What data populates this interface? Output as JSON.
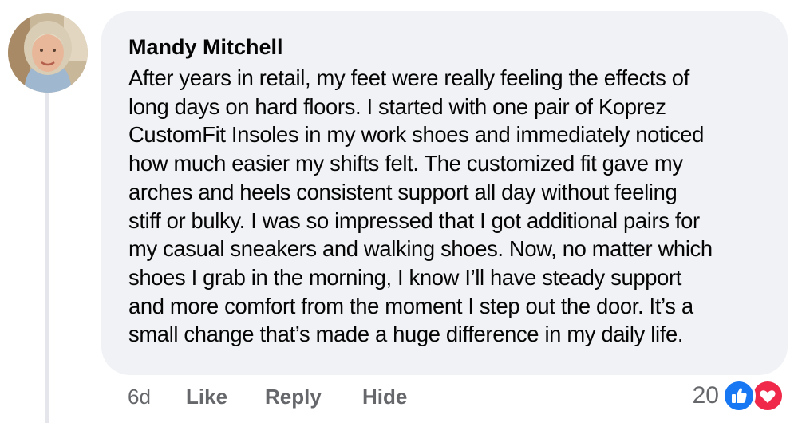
{
  "comment": {
    "author": "Mandy Mitchell",
    "lines": [
      "After years in retail, my feet were really feeling the effects of",
      "long days on hard floors. I started with one pair of Koprez",
      "CustomFit Insoles in my work shoes and immediately noticed",
      "how much easier my shifts felt. The customized fit gave my",
      "arches and heels consistent support all day without feeling",
      "stiff or bulky. I was so impressed that I got additional pairs for",
      "my casual sneakers and walking shoes. Now, no matter which",
      "shoes I grab in the morning, I know I’ll have steady support",
      "and more comfort from the moment I step out the door. It’s a",
      "small change that’s made a huge difference in my daily life."
    ]
  },
  "actions": {
    "time": "6d",
    "like": "Like",
    "reply": "Reply",
    "hide": "Hide"
  },
  "reactions": {
    "count": "20",
    "icons": [
      "thumbs-up-icon",
      "heart-icon"
    ]
  },
  "colors": {
    "bubble": "#f0f2f5",
    "text": "#050505",
    "muted": "#65676b",
    "like_blue": "#1877f2",
    "love_red": "#f02849",
    "thread_line": "#e4e6eb"
  }
}
